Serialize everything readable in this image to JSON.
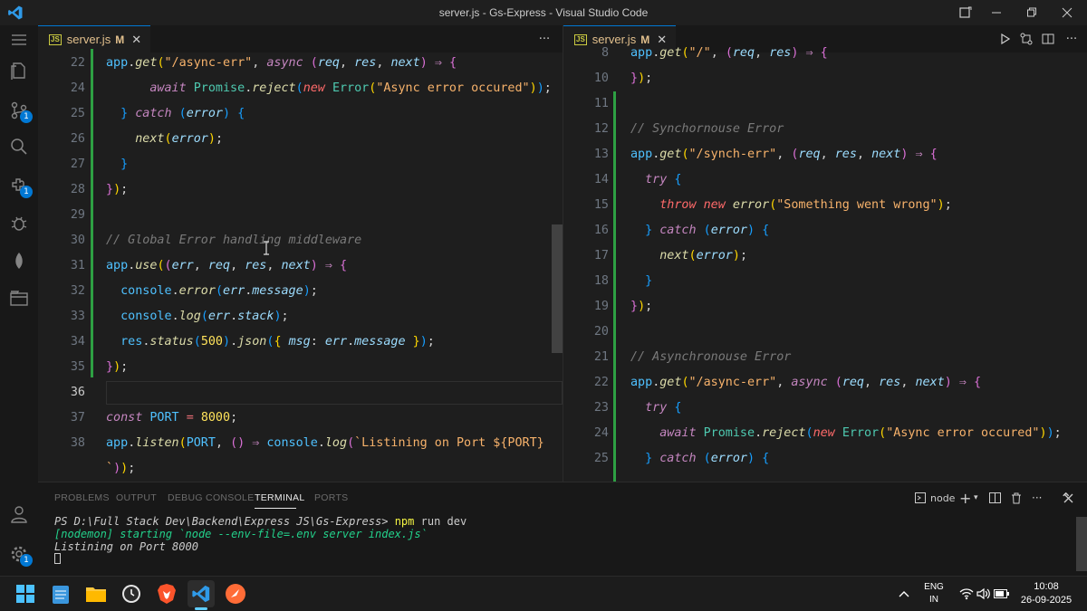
{
  "window": {
    "title": "server.js - Gs-Express - Visual Studio Code"
  },
  "activity_bar": {
    "badges": [
      "1",
      "1",
      "1"
    ]
  },
  "left_editor": {
    "tab": {
      "name": "server.js",
      "modified": "M"
    },
    "active_line": "36",
    "lines": [
      {
        "n": "22",
        "tokens": [
          [
            "v",
            "app"
          ],
          [
            "w",
            "."
          ],
          [
            "f",
            "get"
          ],
          [
            "b",
            "("
          ],
          [
            "s",
            "\"/async-err\""
          ],
          [
            "w",
            ", "
          ],
          [
            "k",
            "async"
          ],
          [
            "w",
            " "
          ],
          [
            "b2",
            "("
          ],
          [
            "p",
            "req"
          ],
          [
            "w",
            ", "
          ],
          [
            "p",
            "res"
          ],
          [
            "w",
            ", "
          ],
          [
            "p",
            "next"
          ],
          [
            "b2",
            ")"
          ],
          [
            "w",
            " "
          ],
          [
            "k",
            "⇒"
          ],
          [
            "w",
            " "
          ],
          [
            "b2",
            "{"
          ]
        ]
      },
      {
        "n": "24",
        "tokens": [
          [
            "w",
            "      "
          ],
          [
            "k",
            "await"
          ],
          [
            "w",
            " "
          ],
          [
            "ca",
            "Promise"
          ],
          [
            "w",
            "."
          ],
          [
            "f",
            "reject"
          ],
          [
            "b3",
            "("
          ],
          [
            "kw",
            "new"
          ],
          [
            "w",
            " "
          ],
          [
            "ca",
            "Error"
          ],
          [
            "b",
            "("
          ],
          [
            "s",
            "\"Async error occured\""
          ],
          [
            "b",
            ")"
          ],
          [
            "b3",
            ")"
          ],
          [
            "w",
            ";"
          ]
        ]
      },
      {
        "n": "25",
        "tokens": [
          [
            "w",
            "  "
          ],
          [
            "b3",
            "}"
          ],
          [
            "w",
            " "
          ],
          [
            "k",
            "catch"
          ],
          [
            "w",
            " "
          ],
          [
            "b3",
            "("
          ],
          [
            "p",
            "error"
          ],
          [
            "b3",
            ")"
          ],
          [
            "w",
            " "
          ],
          [
            "b3",
            "{"
          ]
        ]
      },
      {
        "n": "26",
        "tokens": [
          [
            "w",
            "    "
          ],
          [
            "f",
            "next"
          ],
          [
            "b",
            "("
          ],
          [
            "p",
            "error"
          ],
          [
            "b",
            ")"
          ],
          [
            "w",
            ";"
          ]
        ]
      },
      {
        "n": "27",
        "tokens": [
          [
            "w",
            "  "
          ],
          [
            "b3",
            "}"
          ]
        ]
      },
      {
        "n": "28",
        "tokens": [
          [
            "b2",
            "}"
          ],
          [
            "b",
            ")"
          ],
          [
            "w",
            ";"
          ]
        ]
      },
      {
        "n": "29",
        "tokens": []
      },
      {
        "n": "30",
        "tokens": [
          [
            "c",
            "// Global Error handling middleware"
          ]
        ]
      },
      {
        "n": "31",
        "tokens": [
          [
            "v",
            "app"
          ],
          [
            "w",
            "."
          ],
          [
            "f",
            "use"
          ],
          [
            "b",
            "("
          ],
          [
            "b2",
            "("
          ],
          [
            "p",
            "err"
          ],
          [
            "w",
            ", "
          ],
          [
            "p",
            "req"
          ],
          [
            "w",
            ", "
          ],
          [
            "p",
            "res"
          ],
          [
            "w",
            ", "
          ],
          [
            "p",
            "next"
          ],
          [
            "b2",
            ")"
          ],
          [
            "w",
            " "
          ],
          [
            "k",
            "⇒"
          ],
          [
            "w",
            " "
          ],
          [
            "b2",
            "{"
          ]
        ]
      },
      {
        "n": "32",
        "tokens": [
          [
            "w",
            "  "
          ],
          [
            "v",
            "console"
          ],
          [
            "w",
            "."
          ],
          [
            "f",
            "error"
          ],
          [
            "b3",
            "("
          ],
          [
            "p",
            "err"
          ],
          [
            "w",
            "."
          ],
          [
            "p",
            "message"
          ],
          [
            "b3",
            ")"
          ],
          [
            "w",
            ";"
          ]
        ]
      },
      {
        "n": "33",
        "tokens": [
          [
            "w",
            "  "
          ],
          [
            "v",
            "console"
          ],
          [
            "w",
            "."
          ],
          [
            "f",
            "log"
          ],
          [
            "b3",
            "("
          ],
          [
            "p",
            "err"
          ],
          [
            "w",
            "."
          ],
          [
            "p",
            "stack"
          ],
          [
            "b3",
            ")"
          ],
          [
            "w",
            ";"
          ]
        ]
      },
      {
        "n": "34",
        "tokens": [
          [
            "w",
            "  "
          ],
          [
            "v",
            "res"
          ],
          [
            "w",
            "."
          ],
          [
            "f",
            "status"
          ],
          [
            "b3",
            "("
          ],
          [
            "n",
            "500"
          ],
          [
            "b3",
            ")"
          ],
          [
            "w",
            "."
          ],
          [
            "f",
            "json"
          ],
          [
            "b3",
            "("
          ],
          [
            "b",
            "{"
          ],
          [
            "w",
            " "
          ],
          [
            "p",
            "msg"
          ],
          [
            "w",
            ": "
          ],
          [
            "p",
            "err"
          ],
          [
            "w",
            "."
          ],
          [
            "p",
            "message"
          ],
          [
            "w",
            " "
          ],
          [
            "b",
            "}"
          ],
          [
            "b3",
            ")"
          ],
          [
            "w",
            ";"
          ]
        ]
      },
      {
        "n": "35",
        "tokens": [
          [
            "b2",
            "}"
          ],
          [
            "b",
            ")"
          ],
          [
            "w",
            ";"
          ]
        ]
      },
      {
        "n": "36",
        "tokens": []
      },
      {
        "n": "37",
        "tokens": [
          [
            "k",
            "const"
          ],
          [
            "w",
            " "
          ],
          [
            "v",
            "PORT"
          ],
          [
            "w",
            " "
          ],
          [
            "o",
            "="
          ],
          [
            "w",
            " "
          ],
          [
            "n",
            "8000"
          ],
          [
            "w",
            ";"
          ]
        ]
      },
      {
        "n": "38",
        "tokens": [
          [
            "v",
            "app"
          ],
          [
            "w",
            "."
          ],
          [
            "f",
            "listen"
          ],
          [
            "b",
            "("
          ],
          [
            "v",
            "PORT"
          ],
          [
            "w",
            ", "
          ],
          [
            "b2",
            "("
          ],
          [
            "b2",
            ")"
          ],
          [
            "w",
            " "
          ],
          [
            "k",
            "⇒"
          ],
          [
            "w",
            " "
          ],
          [
            "v",
            "console"
          ],
          [
            "w",
            "."
          ],
          [
            "f",
            "log"
          ],
          [
            "b2",
            "("
          ],
          [
            "s",
            "`Listining on Port ${PORT}"
          ]
        ]
      },
      {
        "n": "",
        "tokens": [
          [
            "s",
            "`"
          ],
          [
            "b2",
            ")"
          ],
          [
            "b",
            ")"
          ],
          [
            "w",
            ";"
          ]
        ]
      }
    ]
  },
  "right_editor": {
    "tab": {
      "name": "server.js",
      "modified": "M"
    },
    "lines": [
      {
        "n": "8",
        "tokens": [
          [
            "v",
            "app"
          ],
          [
            "w",
            "."
          ],
          [
            "f",
            "get"
          ],
          [
            "b",
            "("
          ],
          [
            "s",
            "\"/\""
          ],
          [
            "w",
            ", "
          ],
          [
            "b2",
            "("
          ],
          [
            "p",
            "req"
          ],
          [
            "w",
            ", "
          ],
          [
            "p",
            "res"
          ],
          [
            "b2",
            ")"
          ],
          [
            "w",
            " "
          ],
          [
            "k",
            "⇒"
          ],
          [
            "w",
            " "
          ],
          [
            "b2",
            "{"
          ]
        ]
      },
      {
        "n": "10",
        "tokens": [
          [
            "b2",
            "}"
          ],
          [
            "b",
            ")"
          ],
          [
            "w",
            ";"
          ]
        ]
      },
      {
        "n": "11",
        "tokens": []
      },
      {
        "n": "12",
        "tokens": [
          [
            "c",
            "// Synchornouse Error"
          ]
        ]
      },
      {
        "n": "13",
        "tokens": [
          [
            "v",
            "app"
          ],
          [
            "w",
            "."
          ],
          [
            "f",
            "get"
          ],
          [
            "b",
            "("
          ],
          [
            "s",
            "\"/synch-err\""
          ],
          [
            "w",
            ", "
          ],
          [
            "b2",
            "("
          ],
          [
            "p",
            "req"
          ],
          [
            "w",
            ", "
          ],
          [
            "p",
            "res"
          ],
          [
            "w",
            ", "
          ],
          [
            "p",
            "next"
          ],
          [
            "b2",
            ")"
          ],
          [
            "w",
            " "
          ],
          [
            "k",
            "⇒"
          ],
          [
            "w",
            " "
          ],
          [
            "b2",
            "{"
          ]
        ]
      },
      {
        "n": "14",
        "tokens": [
          [
            "w",
            "  "
          ],
          [
            "k",
            "try"
          ],
          [
            "w",
            " "
          ],
          [
            "b3",
            "{"
          ]
        ]
      },
      {
        "n": "15",
        "tokens": [
          [
            "w",
            "    "
          ],
          [
            "kw",
            "throw"
          ],
          [
            "w",
            " "
          ],
          [
            "kw",
            "new"
          ],
          [
            "w",
            " "
          ],
          [
            "f",
            "error"
          ],
          [
            "b",
            "("
          ],
          [
            "s",
            "\"Something went wrong\""
          ],
          [
            "b",
            ")"
          ],
          [
            "w",
            ";"
          ]
        ]
      },
      {
        "n": "16",
        "tokens": [
          [
            "w",
            "  "
          ],
          [
            "b3",
            "}"
          ],
          [
            "w",
            " "
          ],
          [
            "k",
            "catch"
          ],
          [
            "w",
            " "
          ],
          [
            "b3",
            "("
          ],
          [
            "p",
            "error"
          ],
          [
            "b3",
            ")"
          ],
          [
            "w",
            " "
          ],
          [
            "b3",
            "{"
          ]
        ]
      },
      {
        "n": "17",
        "tokens": [
          [
            "w",
            "    "
          ],
          [
            "f",
            "next"
          ],
          [
            "b",
            "("
          ],
          [
            "p",
            "error"
          ],
          [
            "b",
            ")"
          ],
          [
            "w",
            ";"
          ]
        ]
      },
      {
        "n": "18",
        "tokens": [
          [
            "w",
            "  "
          ],
          [
            "b3",
            "}"
          ]
        ]
      },
      {
        "n": "19",
        "tokens": [
          [
            "b2",
            "}"
          ],
          [
            "b",
            ")"
          ],
          [
            "w",
            ";"
          ]
        ]
      },
      {
        "n": "20",
        "tokens": []
      },
      {
        "n": "21",
        "tokens": [
          [
            "c",
            "// Asynchronouse Error"
          ]
        ]
      },
      {
        "n": "22",
        "tokens": [
          [
            "v",
            "app"
          ],
          [
            "w",
            "."
          ],
          [
            "f",
            "get"
          ],
          [
            "b",
            "("
          ],
          [
            "s",
            "\"/async-err\""
          ],
          [
            "w",
            ", "
          ],
          [
            "k",
            "async"
          ],
          [
            "w",
            " "
          ],
          [
            "b2",
            "("
          ],
          [
            "p",
            "req"
          ],
          [
            "w",
            ", "
          ],
          [
            "p",
            "res"
          ],
          [
            "w",
            ", "
          ],
          [
            "p",
            "next"
          ],
          [
            "b2",
            ")"
          ],
          [
            "w",
            " "
          ],
          [
            "k",
            "⇒"
          ],
          [
            "w",
            " "
          ],
          [
            "b2",
            "{"
          ]
        ]
      },
      {
        "n": "23",
        "tokens": [
          [
            "w",
            "  "
          ],
          [
            "k",
            "try"
          ],
          [
            "w",
            " "
          ],
          [
            "b3",
            "{"
          ]
        ]
      },
      {
        "n": "24",
        "tokens": [
          [
            "w",
            "    "
          ],
          [
            "k",
            "await"
          ],
          [
            "w",
            " "
          ],
          [
            "ca",
            "Promise"
          ],
          [
            "w",
            "."
          ],
          [
            "f",
            "reject"
          ],
          [
            "b3",
            "("
          ],
          [
            "kw",
            "new"
          ],
          [
            "w",
            " "
          ],
          [
            "ca",
            "Error"
          ],
          [
            "b",
            "("
          ],
          [
            "s",
            "\"Async error occured\""
          ],
          [
            "b",
            ")"
          ],
          [
            "b3",
            ")"
          ],
          [
            "w",
            ";"
          ]
        ]
      },
      {
        "n": "25",
        "tokens": [
          [
            "w",
            "  "
          ],
          [
            "b3",
            "}"
          ],
          [
            "w",
            " "
          ],
          [
            "k",
            "catch"
          ],
          [
            "w",
            " "
          ],
          [
            "b3",
            "("
          ],
          [
            "p",
            "error"
          ],
          [
            "b3",
            ")"
          ],
          [
            "w",
            " "
          ],
          [
            "b3",
            "{"
          ]
        ]
      }
    ]
  },
  "panel": {
    "tabs": [
      "PROBLEMS",
      "OUTPUT",
      "DEBUG CONSOLE",
      "TERMINAL",
      "PORTS"
    ],
    "active_tab": "TERMINAL",
    "terminal_name": "node",
    "terminal": {
      "prompt": "PS D:\\Full Stack Dev\\Backend\\Express JS\\Gs-Express>",
      "command": "npm",
      "command_args": " run dev",
      "line2": "[nodemon] starting `node --env-file=.env server index.js`",
      "line3": "Listining on Port 8000"
    }
  },
  "taskbar": {
    "lang_top": "ENG",
    "lang_bottom": "IN",
    "time": "10:08",
    "date": "26-09-2025"
  }
}
